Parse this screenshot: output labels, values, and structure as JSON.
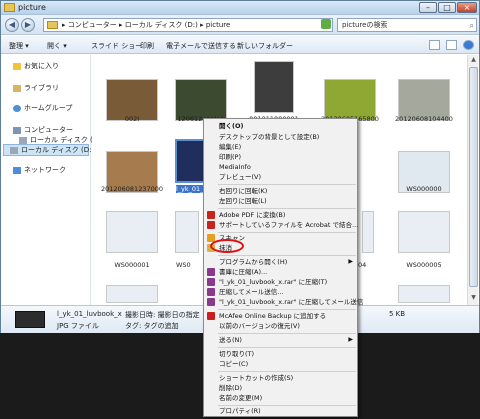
{
  "window": {
    "title": "picture"
  },
  "address": {
    "path": "▸ コンピューター ▸ ローカル ディスク (D:) ▸ picture",
    "search_placeholder": "pictureの検索"
  },
  "toolbar": {
    "items": [
      "整理 ▾",
      "開く ▾",
      "スライド ショー",
      "印刷",
      "電子メールで送信する",
      "新しいフォルダー"
    ]
  },
  "sidebar": {
    "items": [
      {
        "label": "お気に入り"
      },
      {
        "label": "ライブラリ"
      },
      {
        "label": "ホームグループ"
      },
      {
        "label": "コンピューター"
      },
      {
        "label": "ローカル ディスク (C:)"
      },
      {
        "label": "ローカル ディスク (D:)"
      },
      {
        "label": "ネットワーク"
      }
    ]
  },
  "files": [
    {
      "label": "002I"
    },
    {
      "label": "120612apple1"
    },
    {
      "label": "001011000001"
    },
    {
      "label": "20120605165800"
    },
    {
      "label": "20120608104400"
    },
    {
      "label": "201206081237000"
    },
    {
      "label": "l_yk_01_luv"
    },
    {
      "label": "WS000000"
    },
    {
      "label": "WS000001"
    },
    {
      "label": "WS0"
    },
    {
      "label": "04"
    },
    {
      "label": "WS000005"
    }
  ],
  "details": {
    "filename": "l_yk_01_luvbook_x",
    "filetype": "JPG ファイル",
    "date_label": "撮影日時: 撮影日の指定",
    "tag_label": "タグ: タグの追加",
    "size": "5 KB"
  },
  "context_menu": {
    "items": [
      {
        "label": "開く(O)",
        "bold": true
      },
      {
        "label": "デスクトップの背景として設定(B)"
      },
      {
        "label": "編集(E)"
      },
      {
        "label": "印刷(P)"
      },
      {
        "label": "MediaInfo"
      },
      {
        "label": "プレビュー(V)"
      },
      {
        "label": "右回りに回転(K)"
      },
      {
        "label": "左回りに回転(L)"
      },
      {
        "label": "Adobe PDF に変換(B)"
      },
      {
        "label": "サポートしているファイルを Acrobat で結合..."
      },
      {
        "label": "スキャン"
      },
      {
        "label": "抹消"
      },
      {
        "label": "プログラムから開く(H)"
      },
      {
        "label": "書庫に圧縮(A)..."
      },
      {
        "label": "\"l_yk_01_luvbook_x.rar\" に圧縮(T)"
      },
      {
        "label": "圧縮してメール送信..."
      },
      {
        "label": "\"l_yk_01_luvbook_x.rar\" に圧縮してメール送信"
      },
      {
        "label": "McAfee Online Backup に追加する"
      },
      {
        "label": "以前のバージョンの復元(V)"
      },
      {
        "label": "送る(N)"
      },
      {
        "label": "切り取り(T)"
      },
      {
        "label": "コピー(C)"
      },
      {
        "label": "ショートカットの作成(S)"
      },
      {
        "label": "削除(D)"
      },
      {
        "label": "名前の変更(M)"
      },
      {
        "label": "プロパティ(R)"
      }
    ]
  }
}
